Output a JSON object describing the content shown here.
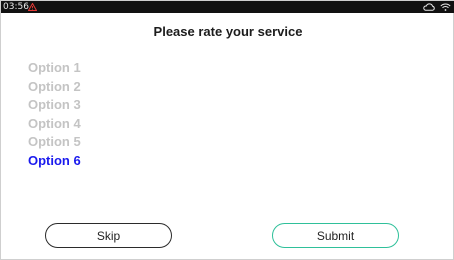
{
  "status_bar": {
    "time": "03:56",
    "alert_icon": "warning-triangle-icon",
    "alert_color": "#e53935",
    "cloud_icon": "cloud-icon",
    "wifi_icon": "wifi-icon"
  },
  "title": "Please rate your service",
  "options": [
    {
      "label": "Option 1",
      "selected": false
    },
    {
      "label": "Option 2",
      "selected": false
    },
    {
      "label": "Option 3",
      "selected": false
    },
    {
      "label": "Option 4",
      "selected": false
    },
    {
      "label": "Option 5",
      "selected": false
    },
    {
      "label": "Option 6",
      "selected": true
    }
  ],
  "buttons": {
    "skip_label": "Skip",
    "submit_label": "Submit"
  },
  "colors": {
    "selected_option": "#1a1aee",
    "unselected_option": "#c4c4c4",
    "submit_border": "#2fc09a",
    "skip_border": "#2b2b2b"
  }
}
